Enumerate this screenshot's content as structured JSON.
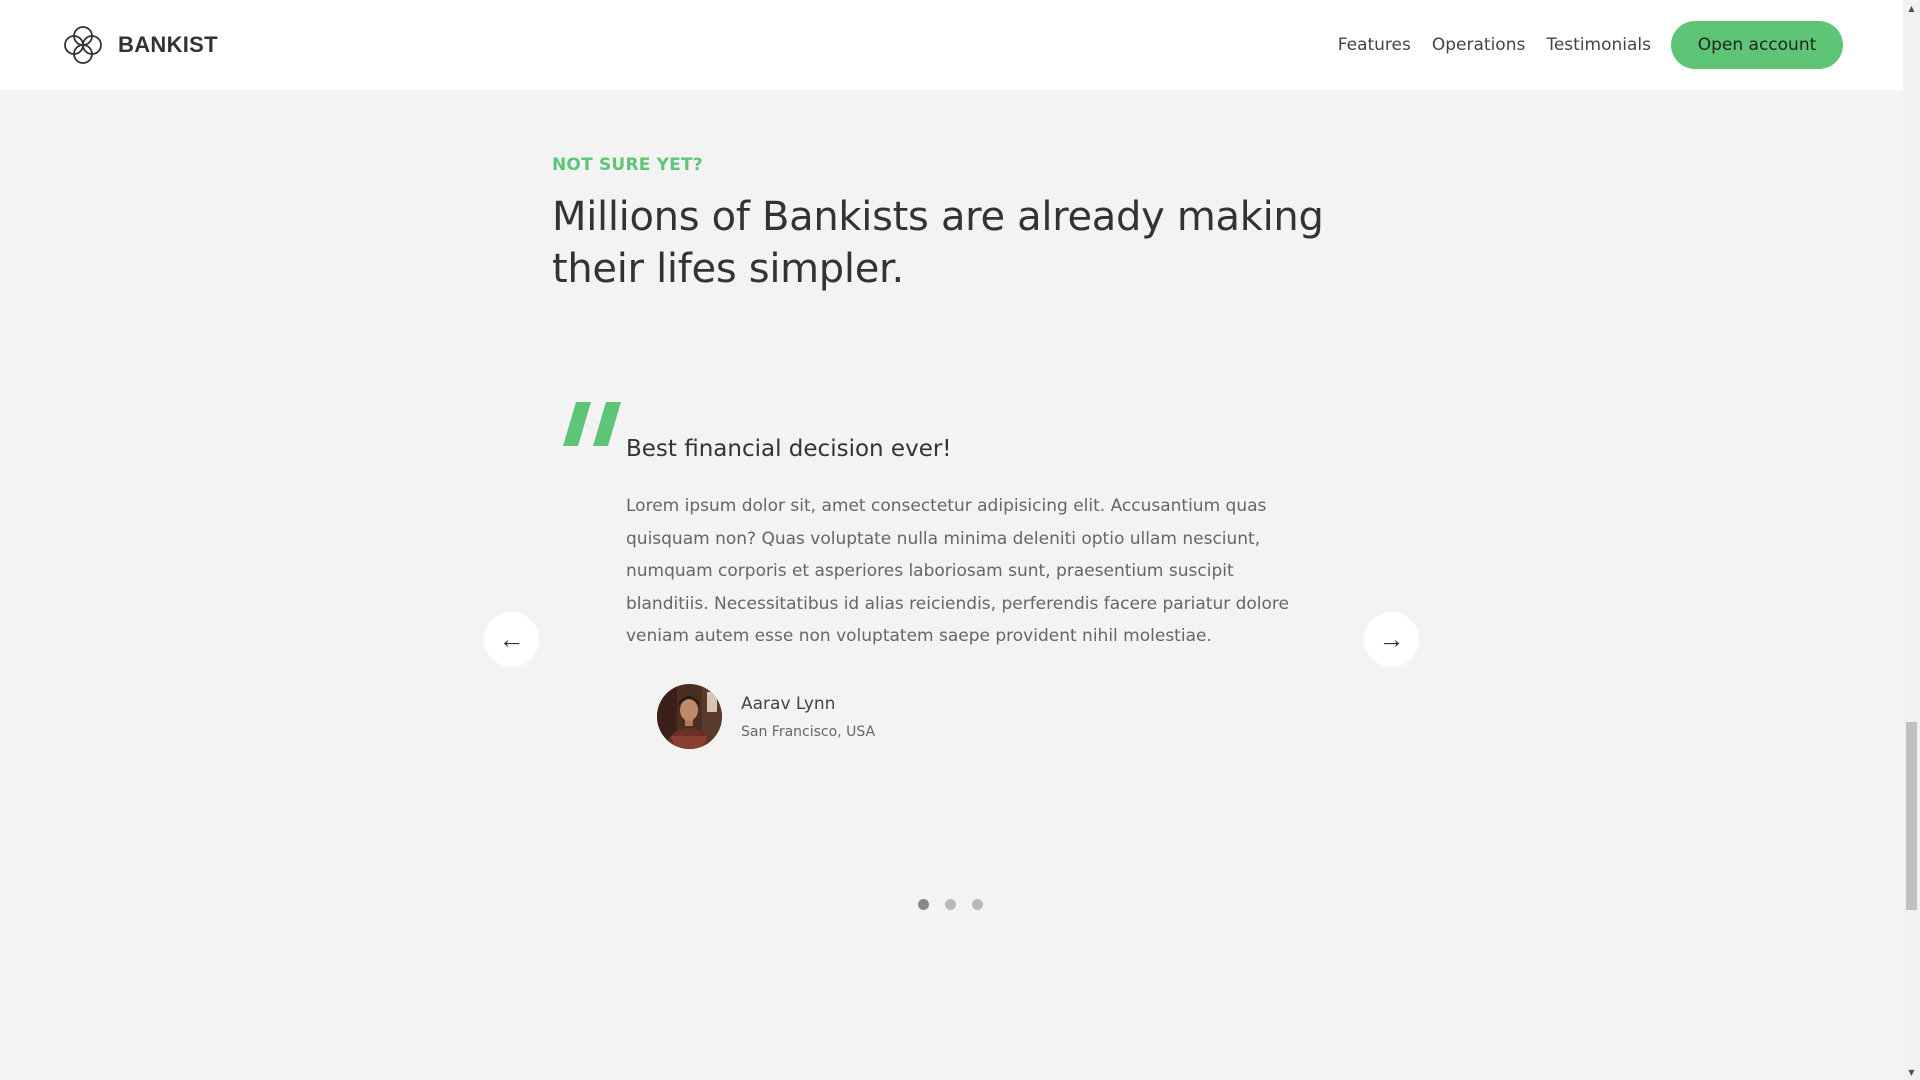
{
  "header": {
    "brand": "BANKIST",
    "nav": [
      {
        "label": "Features"
      },
      {
        "label": "Operations"
      },
      {
        "label": "Testimonials"
      }
    ],
    "cta_label": "Open account"
  },
  "section": {
    "eyebrow": "Not sure yet?",
    "title_line1": "Millions of Bankists are already making",
    "title_line2": "their lifes simpler."
  },
  "testimonial": {
    "title": "Best financial decision ever!",
    "text": "Lorem ipsum dolor sit, amet consectetur adipisicing elit. Accusantium quas quisquam non? Quas voluptate nulla minima deleniti optio ullam nesciunt, numquam corporis et asperiores laboriosam sunt, praesentium suscipit blanditiis. Necessitatibus id alias reiciendis, perferendis facere pariatur dolore veniam autem esse non voluptatem saepe provident nihil molestiae.",
    "author": {
      "name": "Aarav Lynn",
      "location": "San Francisco, USA"
    }
  },
  "slider": {
    "prev_icon": "←",
    "next_icon": "→",
    "dot_count": 3,
    "active_index": 0
  },
  "colors": {
    "accent": "#5ec576",
    "background": "#f3f3f3",
    "header_bg": "#ffffff",
    "heading": "#333333",
    "body_text": "#666666"
  },
  "icons": {
    "logo": "bankist-logo-icon",
    "quote": "quote-icon",
    "prev": "arrow-left-icon",
    "next": "arrow-right-icon"
  }
}
